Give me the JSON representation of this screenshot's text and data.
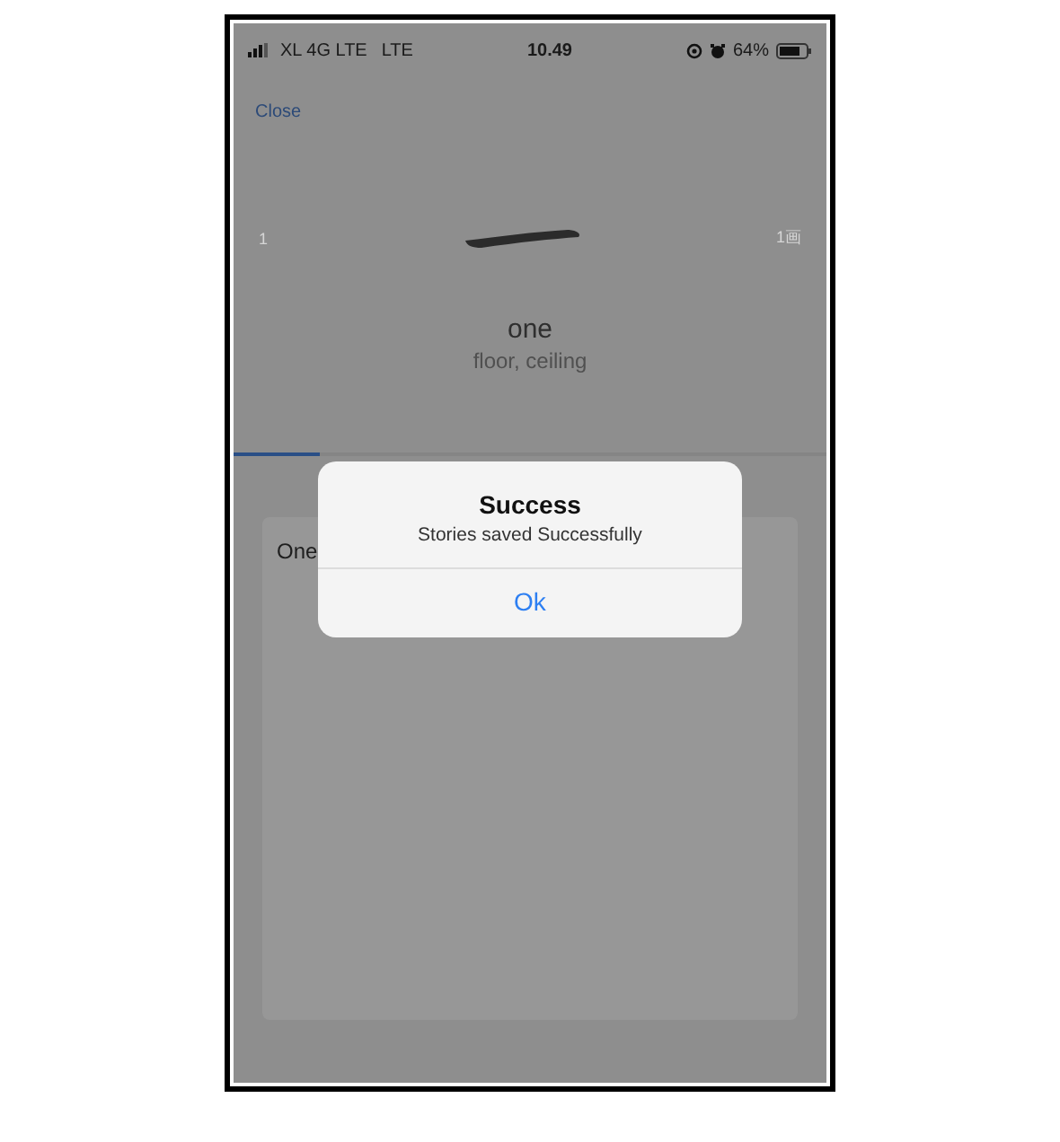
{
  "status_bar": {
    "carrier": "XL 4G LTE",
    "network": "LTE",
    "time": "10.49",
    "battery": "64%"
  },
  "close_link": "Close",
  "character": {
    "index": "1",
    "stroke_count": "1画",
    "word": "one",
    "gloss": "floor, ceiling"
  },
  "story_card": {
    "text": "One"
  },
  "alert": {
    "title": "Success",
    "message": "Stories saved Successfully",
    "button": "Ok"
  }
}
